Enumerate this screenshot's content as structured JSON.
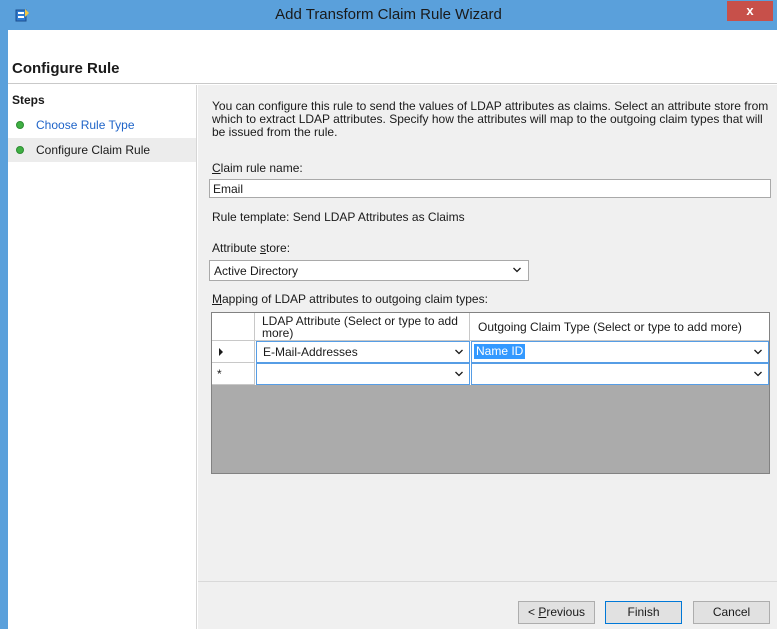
{
  "window": {
    "title": "Add Transform Claim Rule Wizard",
    "close_glyph": "x",
    "app_icon": "wizard-app-icon"
  },
  "header": {
    "title": "Configure Rule"
  },
  "steps": {
    "title": "Steps",
    "items": [
      {
        "label": "Choose Rule Type",
        "status": "complete",
        "color": "#1f64c8"
      },
      {
        "label": "Configure Claim Rule",
        "status": "current",
        "color": "#1a1a1a"
      }
    ]
  },
  "form": {
    "description": "You can configure this rule to send the values of LDAP attributes as claims. Select an attribute store from which to extract LDAP attributes. Specify how the attributes will map to the outgoing claim types that will be issued from the rule.",
    "claim_rule_name_label_mnemonic": "C",
    "claim_rule_name_label_rest": "laim rule name:",
    "claim_rule_name_value": "Email",
    "rule_template_text": "Rule template: Send LDAP Attributes as Claims",
    "attribute_store_label_pre": "Attribute ",
    "attribute_store_label_mnemonic": "s",
    "attribute_store_label_post": "tore:",
    "attribute_store_value": "Active Directory",
    "mapping_label_mnemonic": "M",
    "mapping_label_rest": "apping of LDAP attributes to outgoing claim types:"
  },
  "mapping_table": {
    "columns": [
      "LDAP Attribute (Select or type to add more)",
      "Outgoing Claim Type (Select or type to add more)"
    ],
    "rows": [
      {
        "row_marker": "current",
        "ldap_attribute": "E-Mail-Addresses",
        "claim_type": "Name ID"
      },
      {
        "row_marker": "*",
        "ldap_attribute": "",
        "claim_type": ""
      }
    ]
  },
  "footer": {
    "previous_pre": "< ",
    "previous_mnemonic": "P",
    "previous_rest": "revious",
    "finish_label": "Finish",
    "cancel_label": "Cancel"
  },
  "colors": {
    "titlebar": "#5aa0db",
    "close": "#c7504a",
    "accent_link": "#1f64c8",
    "step_dot": "#3fb043",
    "selection": "#3399ff"
  }
}
